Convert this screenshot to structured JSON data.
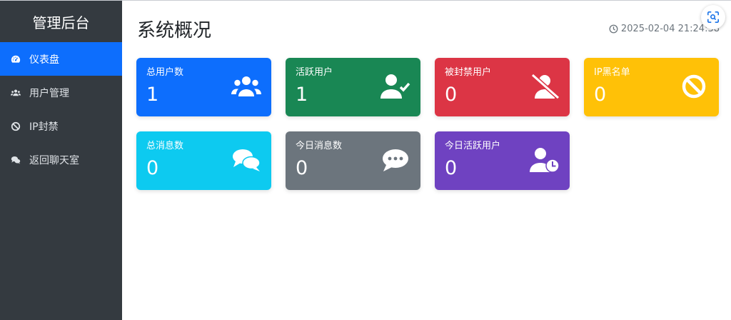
{
  "sidebar": {
    "title": "管理后台",
    "items": [
      {
        "label": "仪表盘",
        "icon": "tachometer-icon",
        "active": true
      },
      {
        "label": "用户管理",
        "icon": "users-icon",
        "active": false
      },
      {
        "label": "IP封禁",
        "icon": "ban-icon",
        "active": false
      },
      {
        "label": "返回聊天室",
        "icon": "comments-icon",
        "active": false
      }
    ]
  },
  "header": {
    "title": "系统概况",
    "datetime": "2025-02-04 21:24:38"
  },
  "stats": [
    {
      "label": "总用户数",
      "value": "1",
      "icon": "users-icon",
      "color": "#0d6efd"
    },
    {
      "label": "活跃用户",
      "value": "1",
      "icon": "user-check-icon",
      "color": "#198754"
    },
    {
      "label": "被封禁用户",
      "value": "0",
      "icon": "user-slash-icon",
      "color": "#dc3545"
    },
    {
      "label": "IP黑名单",
      "value": "0",
      "icon": "ban-icon",
      "color": "#ffc107"
    },
    {
      "label": "总消息数",
      "value": "0",
      "icon": "comments-icon",
      "color": "#0dcaf0"
    },
    {
      "label": "今日消息数",
      "value": "0",
      "icon": "comment-dots-icon",
      "color": "#6c757d"
    },
    {
      "label": "今日活跃用户",
      "value": "0",
      "icon": "user-clock-icon",
      "color": "#6f42c1"
    }
  ]
}
